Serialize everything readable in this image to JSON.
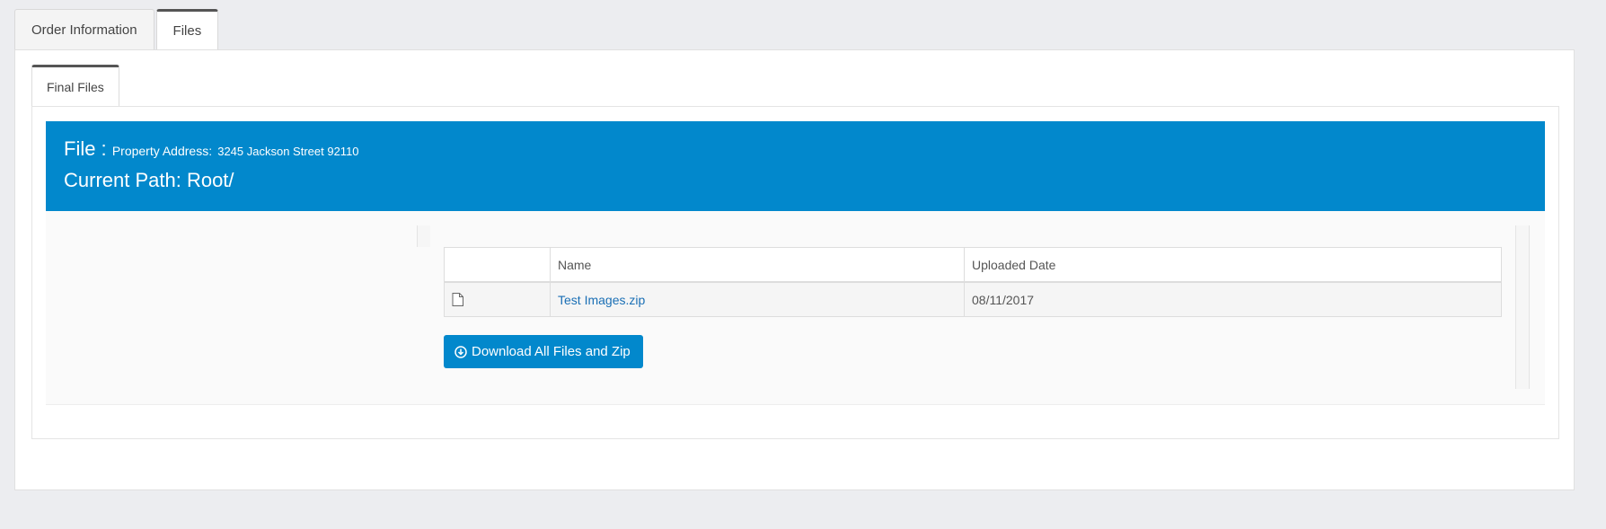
{
  "tabs": {
    "order_info": "Order Information",
    "files": "Files"
  },
  "inner_tabs": {
    "final_files": "Final Files"
  },
  "header": {
    "file_prefix": "File :",
    "property_label": "Property Address:",
    "property_value": "3245 Jackson Street 92110",
    "path_label": "Current Path: Root/"
  },
  "table": {
    "columns": [
      "",
      "Name",
      "Uploaded Date"
    ],
    "rows": [
      {
        "icon": "file-icon",
        "name": "Test Images.zip",
        "date": "08/11/2017"
      }
    ]
  },
  "download_button": {
    "label": "Download All Files and Zip",
    "icon": "download-circle-icon"
  },
  "colors": {
    "accent": "#0288cc",
    "link": "#1a6fb5",
    "background": "#ecedf0"
  }
}
